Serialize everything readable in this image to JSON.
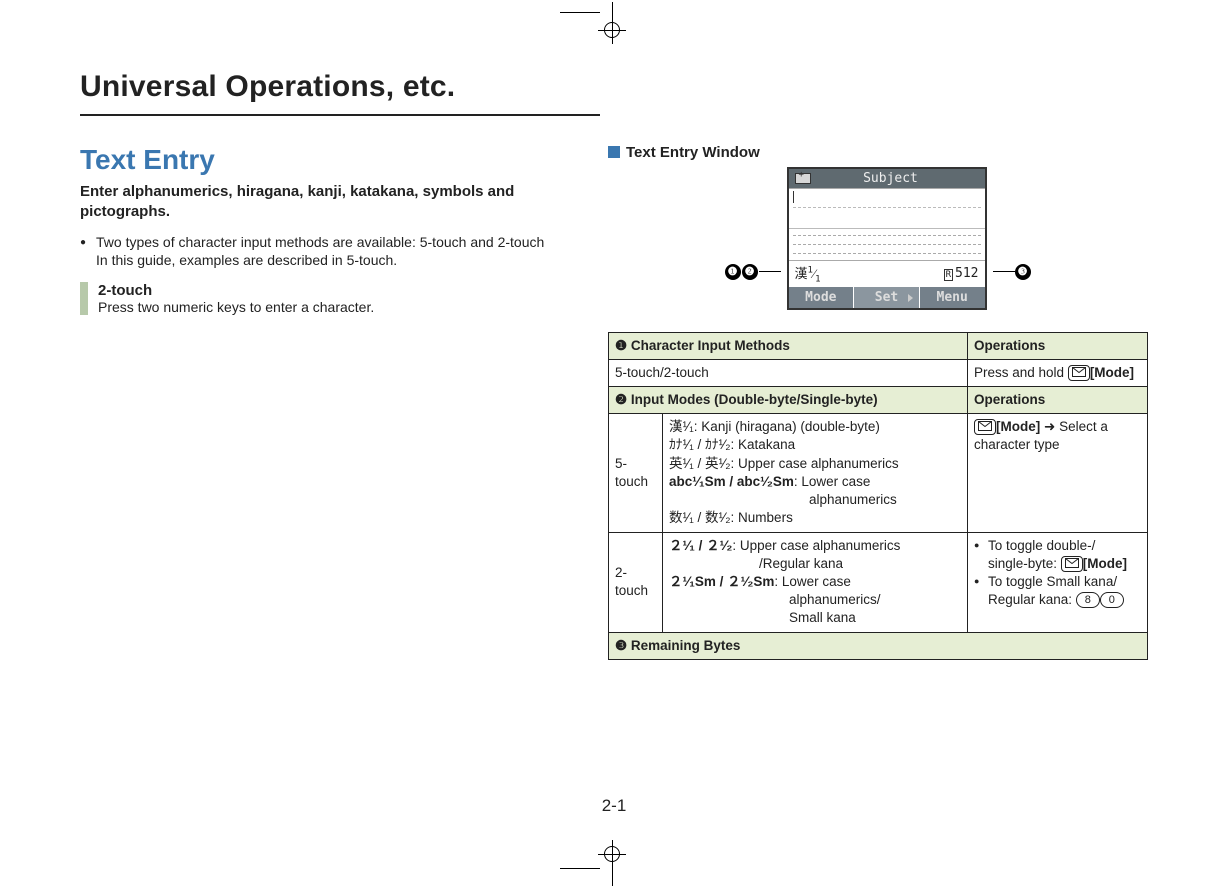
{
  "chapter_title": "Universal Operations, etc.",
  "section_title": "Text Entry",
  "intro": "Enter alphanumerics, hiragana, kanji, katakana, symbols and pictographs.",
  "bullet1": "Two types of character input methods are available: 5-touch and 2-touch",
  "bullet1_line2": "In this guide, examples are described in 5-touch.",
  "note": {
    "title": "2-touch",
    "body": "Press two numeric keys to enter a character."
  },
  "window_heading": "Text Entry Window",
  "callouts": {
    "c1": "❶",
    "c2": "❷",
    "c3": "❸"
  },
  "phone": {
    "title": "Subject",
    "mode_indicator": "漢",
    "bytes": "512",
    "r_label": "R",
    "soft_left": "Mode",
    "soft_mid": "Set",
    "soft_right": "Menu"
  },
  "table": {
    "h1_left": "❶ Character Input Methods",
    "h1_right": "Operations",
    "r1_left": "5-touch/2-touch",
    "r1_right_prefix": "Press and hold ",
    "r1_right_suffix": "[Mode]",
    "h2_left": "❷ Input Modes (Double-byte/Single-byte)",
    "h2_right": "Operations",
    "r2a_label": "5-touch",
    "r2a_line1": "漢¹⁄₁: Kanji (hiragana) (double-byte)",
    "r2a_line2": "ｶﾅ¹⁄₁ / ｶﾅ¹⁄₂: Katakana",
    "r2a_line3": "英¹⁄₁ / 英¹⁄₂: Upper case alphanumerics",
    "r2a_line4_bold": "abc¹⁄₁Sm / abc¹⁄₂Sm",
    "r2a_line4_rest": ": Lower case",
    "r2a_line4_wrap": "alphanumerics",
    "r2a_line5": "数¹⁄₁ / 数¹⁄₂: Numbers",
    "r2a_ops_prefix": "",
    "r2a_ops_mode": "[Mode]",
    "r2a_ops_arrow": " ➜ ",
    "r2a_ops_rest": "Select a character type",
    "r2b_label": "2-touch",
    "r2b_line1_bold": "２¹⁄₁ / ２¹⁄₂",
    "r2b_line1_rest": ": Upper case alphanumerics",
    "r2b_line1_wrap": "/Regular kana",
    "r2b_line2_bold": "２¹⁄₁Sm / ２¹⁄₂Sm",
    "r2b_line2_rest": ": Lower case",
    "r2b_line2_wrap1": "alphanumerics/",
    "r2b_line2_wrap2": "Small kana",
    "r2b_ops1_pre": "To toggle double-/",
    "r2b_ops1_line2_pre": "single-byte: ",
    "r2b_ops1_mode": "[Mode]",
    "r2b_ops2_pre": "To toggle Small kana/",
    "r2b_ops2_line2_pre": "Regular kana: ",
    "r2b_ops2_key8": "8",
    "r2b_ops2_key0": "0",
    "h3": "❸ Remaining Bytes"
  },
  "page_number": "2-1"
}
